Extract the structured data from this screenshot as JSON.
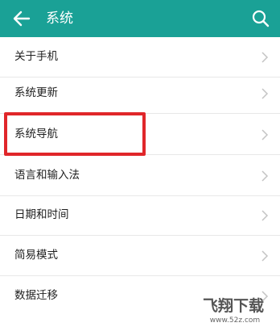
{
  "header": {
    "title": "系统",
    "back_icon": "arrow-left-icon",
    "search_icon": "search-icon"
  },
  "menu": {
    "items": [
      {
        "label": "关于手机"
      },
      {
        "label": "系统更新"
      },
      {
        "label": "系统导航"
      },
      {
        "label": "语言和输入法"
      },
      {
        "label": "日期和时间"
      },
      {
        "label": "简易模式"
      },
      {
        "label": "数据迁移"
      }
    ]
  },
  "highlight_color": "#e0262a",
  "accent_color": "#1aa196",
  "watermark": {
    "main": "飞翔下载",
    "sub": "www.52z.com"
  }
}
